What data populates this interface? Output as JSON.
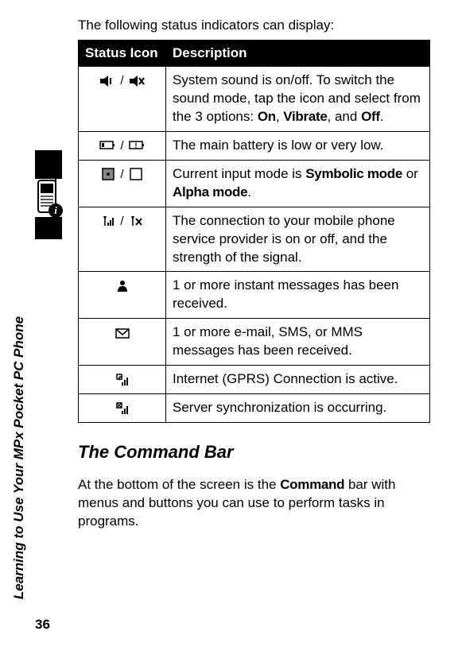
{
  "page": {
    "intro": "The following status indicators can display:",
    "side_title": "Learning to Use Your MPx Pocket PC Phone",
    "page_number": "36"
  },
  "table": {
    "header_icon": "Status Icon",
    "header_desc": "Description",
    "rows": [
      {
        "icons": [
          "speaker-on-icon",
          "speaker-off-icon"
        ],
        "desc_pre": "System sound is on/off. To switch the sound mode, tap the icon and select from the 3 options: ",
        "opt1": "On",
        "sep1": ", ",
        "opt2": "Vibrate",
        "sep2": ", and ",
        "opt3": "Off",
        "tail": "."
      },
      {
        "icons": [
          "battery-low-icon",
          "battery-very-low-icon"
        ],
        "desc": "The main battery is low or very low."
      },
      {
        "icons": [
          "symbolic-mode-icon",
          "alpha-mode-icon"
        ],
        "desc_pre": "Current input mode is ",
        "opt1": "Symbolic mode",
        "sep1": " or ",
        "opt2": "Alpha mode",
        "tail": "."
      },
      {
        "icons": [
          "signal-on-icon",
          "signal-off-icon"
        ],
        "desc": "The connection to your mobile phone service provider is on or off, and the strength of the signal."
      },
      {
        "icons": [
          "im-icon"
        ],
        "desc": "1 or more instant messages has been received."
      },
      {
        "icons": [
          "mail-icon"
        ],
        "desc": "1 or more e-mail, SMS, or MMS messages has been received."
      },
      {
        "icons": [
          "gprs-icon"
        ],
        "desc": "Internet (GPRS) Connection is active."
      },
      {
        "icons": [
          "sync-icon"
        ],
        "desc": "Server synchronization is occurring."
      }
    ]
  },
  "section": {
    "heading": "The Command Bar",
    "text_pre": "At the bottom of the screen is the ",
    "cmd": "Command",
    "text_post": " bar with menus and buttons you can use to perform tasks in programs."
  },
  "sep": " / "
}
